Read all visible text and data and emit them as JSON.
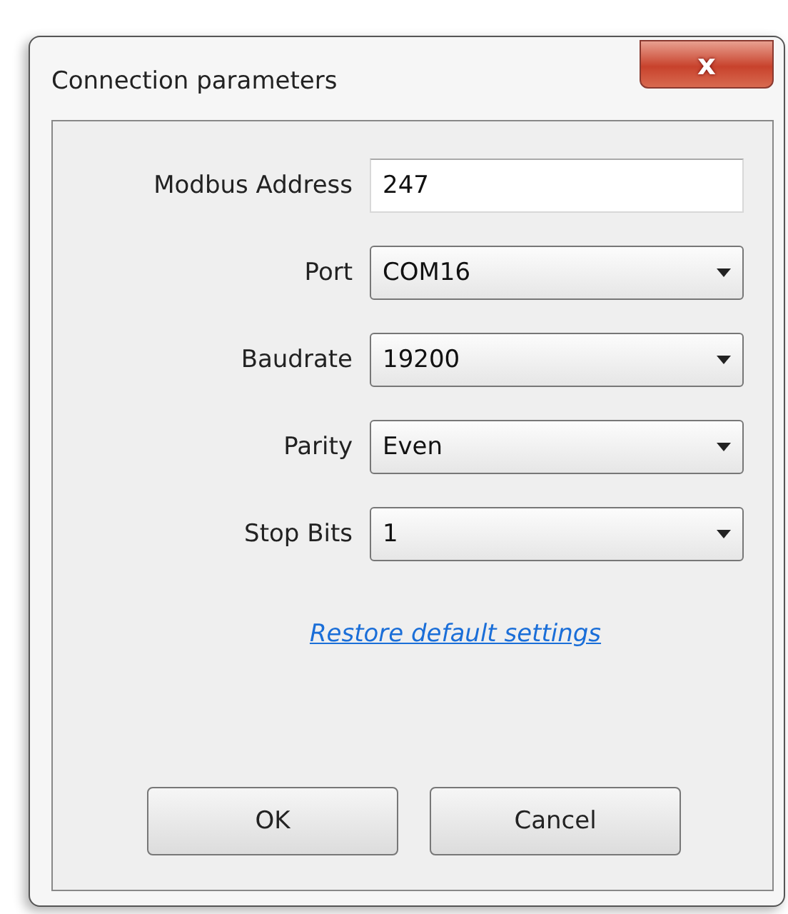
{
  "window": {
    "title": "Connection parameters",
    "close": "x"
  },
  "fields": [
    {
      "kind": "text",
      "label": "Modbus Address",
      "value": "247"
    },
    {
      "kind": "combo",
      "label": "Port",
      "value": "COM16"
    },
    {
      "kind": "combo",
      "label": "Baudrate",
      "value": "19200"
    },
    {
      "kind": "combo",
      "label": "Parity",
      "value": "Even"
    },
    {
      "kind": "combo",
      "label": "Stop Bits",
      "value": "1"
    }
  ],
  "link": "Restore default settings",
  "buttons": [
    "OK",
    "Cancel"
  ]
}
